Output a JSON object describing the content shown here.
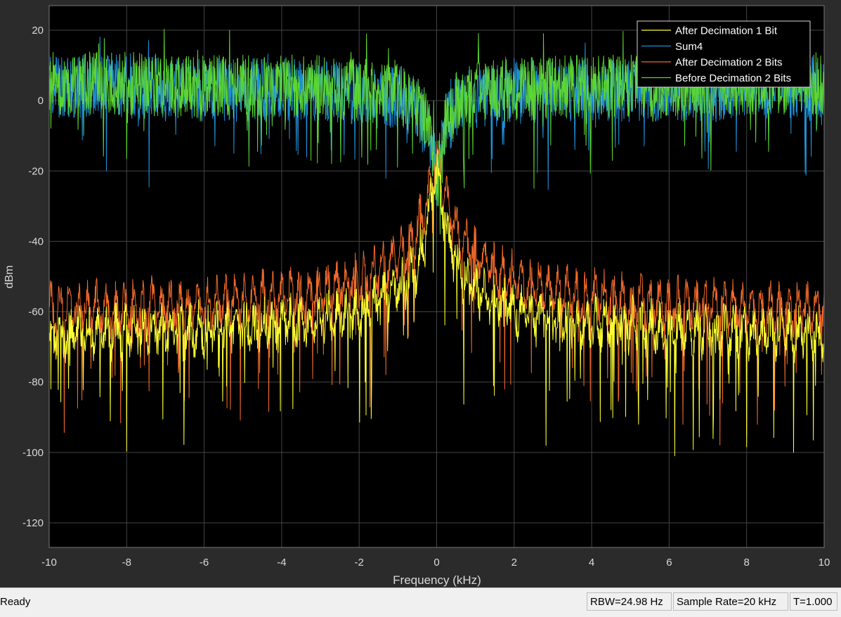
{
  "window": {
    "status": "Ready",
    "rbw": "RBW=24.98 Hz",
    "sample_rate": "Sample Rate=20 kHz",
    "time": "T=1.000"
  },
  "colors": {
    "figure_bg": "#2b2b2b",
    "axes_bg": "#000000",
    "grid": "#444444",
    "tick_text": "#d9d9d9",
    "series": [
      "#ffff33",
      "#1f8fd8",
      "#f26a2a",
      "#5cd632"
    ]
  },
  "chart_data": {
    "type": "line",
    "title": "",
    "xlabel": "Frequency (kHz)",
    "ylabel": "dBm",
    "xlim": [
      -10,
      10
    ],
    "ylim": [
      -127,
      27
    ],
    "xticks": [
      -10,
      -8,
      -6,
      -4,
      -2,
      0,
      2,
      4,
      6,
      8,
      10
    ],
    "yticks": [
      20,
      0,
      -20,
      -40,
      -60,
      -80,
      -100,
      -120
    ],
    "xtick_labels": [
      "-10",
      "-8",
      "-6",
      "-4",
      "-2",
      "0",
      "2",
      "4",
      "6",
      "8",
      "10"
    ],
    "ytick_labels": [
      "20",
      "0",
      "-20",
      "-40",
      "-60",
      "-80",
      "-100",
      "-120"
    ],
    "grid": true,
    "legend_position": "top-right",
    "series": [
      {
        "name": "After Decimation 1 Bit",
        "color": "#ffff33",
        "x": [
          -10,
          -9,
          -8,
          -7,
          -6,
          -5,
          -4,
          -3,
          -2,
          -1.5,
          -1,
          -0.6,
          -0.3,
          0,
          0.3,
          0.6,
          1,
          1.5,
          2,
          3,
          4,
          5,
          6,
          7,
          8,
          9,
          10
        ],
        "y": [
          -62,
          -61,
          -61,
          -60,
          -60,
          -59,
          -58,
          -57,
          -55,
          -52,
          -49,
          -44,
          -35,
          -14,
          -35,
          -44,
          -49,
          -52,
          -55,
          -57,
          -58,
          -59,
          -60,
          -60,
          -61,
          -61,
          -62
        ]
      },
      {
        "name": "Sum4",
        "color": "#1f8fd8",
        "x": [
          -10,
          -9,
          -8,
          -7,
          -6,
          -5,
          -4,
          -3,
          -2,
          -1,
          -0.5,
          -0.2,
          0,
          0.2,
          0.5,
          1,
          2,
          3,
          4,
          5,
          6,
          7,
          8,
          9,
          10
        ],
        "y": [
          4,
          4,
          4,
          3,
          3,
          3,
          3,
          3,
          2,
          1,
          -2,
          -8,
          -22,
          -8,
          -2,
          1,
          2,
          3,
          3,
          3,
          3,
          3,
          4,
          4,
          4
        ]
      },
      {
        "name": "After Decimation 2 Bits",
        "color": "#f26a2a",
        "x": [
          -10,
          -9,
          -8,
          -7,
          -6,
          -5,
          -4,
          -3,
          -2,
          -1.5,
          -1,
          -0.6,
          -0.3,
          0,
          0.3,
          0.6,
          1,
          1.5,
          2,
          3,
          4,
          5,
          6,
          7,
          8,
          9,
          10
        ],
        "y": [
          -55,
          -55,
          -55,
          -54,
          -54,
          -53,
          -52,
          -50,
          -47,
          -44,
          -40,
          -35,
          -27,
          -12,
          -27,
          -35,
          -40,
          -44,
          -47,
          -50,
          -52,
          -53,
          -54,
          -54,
          -55,
          -55,
          -55
        ]
      },
      {
        "name": "Before Decimation 2 Bits",
        "color": "#5cd632",
        "x": [
          -10,
          -9,
          -8,
          -7,
          -6,
          -5,
          -4,
          -3,
          -2,
          -1,
          -0.5,
          -0.2,
          0,
          0.2,
          0.5,
          1,
          2,
          3,
          4,
          5,
          6,
          7,
          8,
          9,
          10
        ],
        "y": [
          5,
          5,
          5,
          4,
          4,
          4,
          4,
          4,
          3,
          2,
          -1,
          -7,
          -25,
          -7,
          -1,
          2,
          3,
          4,
          4,
          4,
          4,
          4,
          5,
          5,
          5
        ]
      }
    ]
  }
}
